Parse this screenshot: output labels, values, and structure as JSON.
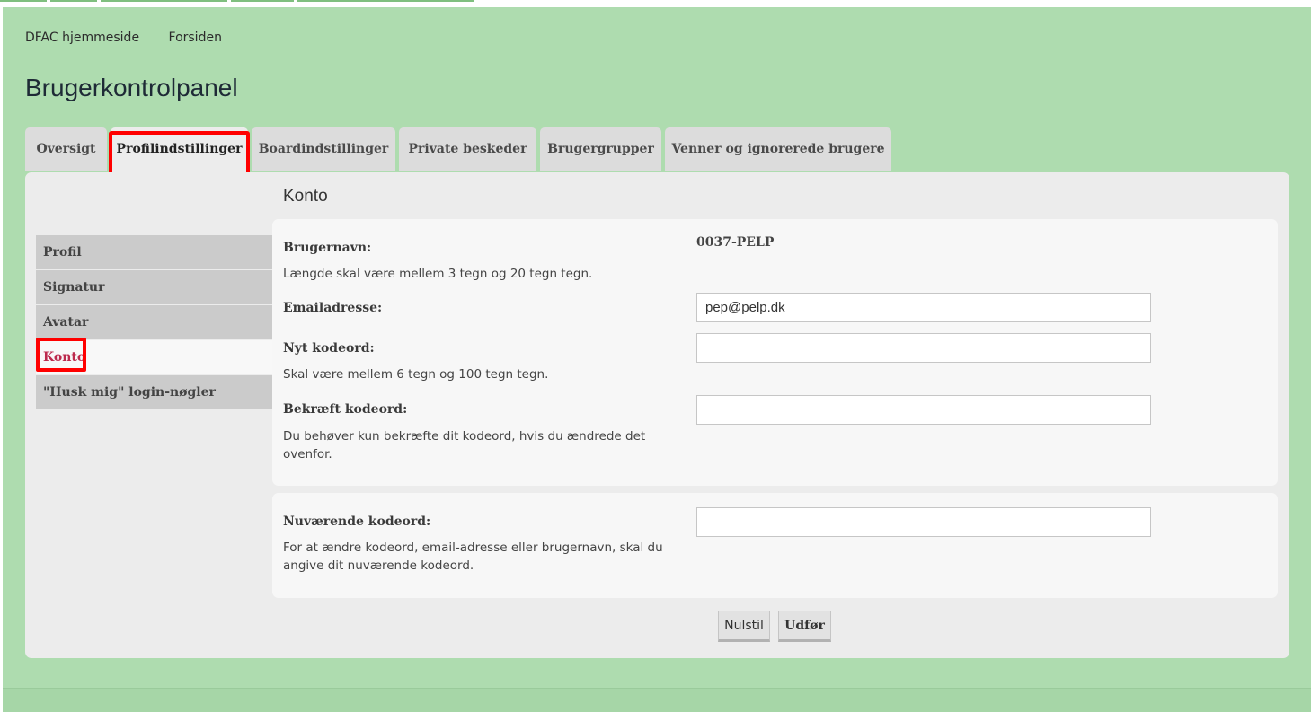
{
  "nav": {
    "links": [
      "DFAC hjemmeside",
      "Forsiden"
    ]
  },
  "page_title": "Brugerkontrolpanel",
  "tabs": [
    {
      "label": "Oversigt",
      "active": false
    },
    {
      "label": "Profilindstillinger",
      "active": true
    },
    {
      "label": "Boardindstillinger",
      "active": false
    },
    {
      "label": "Private beskeder",
      "active": false
    },
    {
      "label": "Brugergrupper",
      "active": false
    },
    {
      "label": "Venner og ignorerede brugere",
      "active": false
    }
  ],
  "sidebar": {
    "items": [
      {
        "label": "Profil",
        "active": false
      },
      {
        "label": "Signatur",
        "active": false
      },
      {
        "label": "Avatar",
        "active": false
      },
      {
        "label": "Konto",
        "active": true
      },
      {
        "label": "\"Husk mig\" login-nøgler",
        "active": false
      }
    ]
  },
  "section_title": "Konto",
  "form": {
    "username": {
      "label": "Brugernavn:",
      "hint": "Længde skal være mellem 3 tegn og 20 tegn tegn.",
      "value": "0037-PELP"
    },
    "email": {
      "label": "Emailadresse:",
      "value": "pep@pelp.dk"
    },
    "new_password": {
      "label": "Nyt kodeord:",
      "hint": "Skal være mellem 6 tegn og 100 tegn tegn.",
      "value": ""
    },
    "confirm_password": {
      "label": "Bekræft kodeord:",
      "hint": "Du behøver kun bekræfte dit kodeord, hvis du ændrede det ovenfor.",
      "value": ""
    },
    "current_password": {
      "label": "Nuværende kodeord:",
      "hint": "For at ændre kodeord, email-adresse eller brugernavn, skal du angive dit nuværende kodeord.",
      "value": ""
    }
  },
  "buttons": {
    "reset": "Nulstil",
    "submit": "Udfør"
  },
  "colors": {
    "page_bg": "#aedcaf",
    "panel_bg": "#ececec",
    "tab_bg": "#dcdcdc",
    "sidebar_item_bg": "#cbcbcb",
    "active_link": "#bc2a4d",
    "highlight": "#ff0000"
  }
}
